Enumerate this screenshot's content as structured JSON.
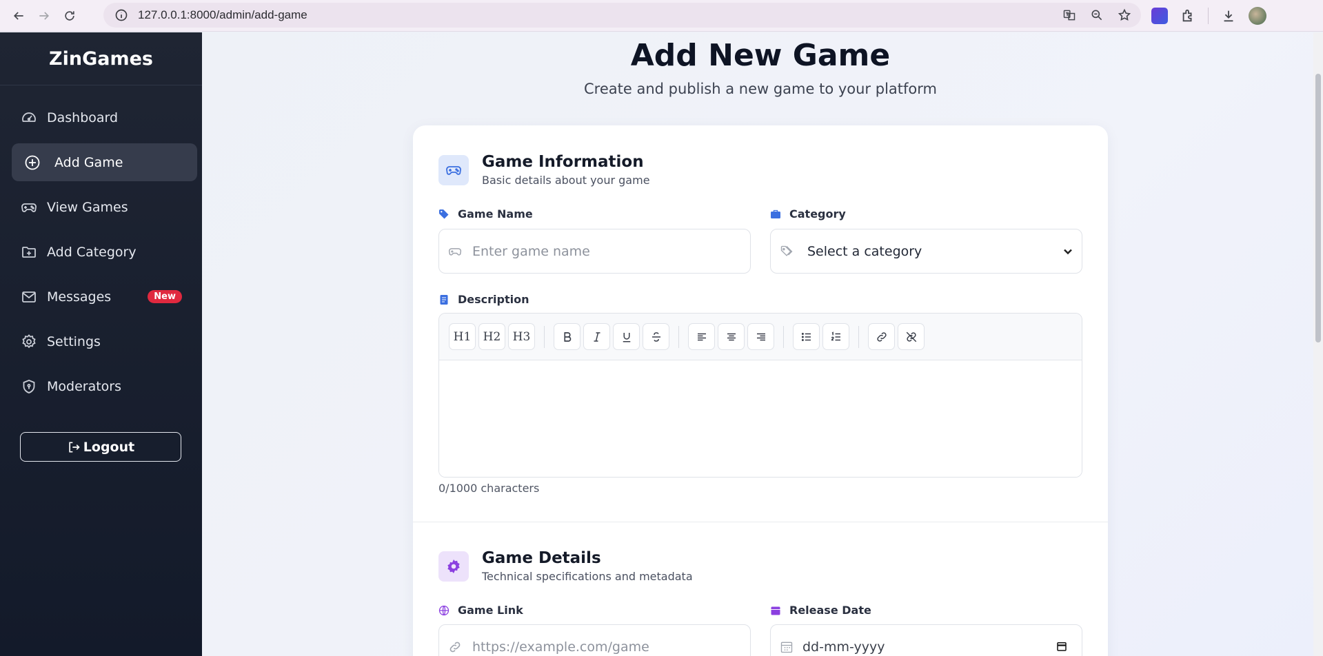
{
  "browser": {
    "url": "127.0.0.1:8000/admin/add-game"
  },
  "sidebar": {
    "brand": "ZinGames",
    "items": [
      {
        "label": "Dashboard"
      },
      {
        "label": "Add Game"
      },
      {
        "label": "View Games"
      },
      {
        "label": "Add Category"
      },
      {
        "label": "Messages",
        "badge": "New"
      },
      {
        "label": "Settings"
      },
      {
        "label": "Moderators"
      }
    ],
    "logout_label": "Logout"
  },
  "main": {
    "title": "Add New Game",
    "subtitle": "Create and publish a new game to your platform"
  },
  "game_info": {
    "title": "Game Information",
    "description": "Basic details about your game",
    "name_label": "Game Name",
    "name_placeholder": "Enter game name",
    "category_label": "Category",
    "category_value": "Select a category",
    "description_label": "Description",
    "toolbar": {
      "h1": "H1",
      "h2": "H2",
      "h3": "H3"
    },
    "char_count": "0/1000 characters"
  },
  "game_details": {
    "title": "Game Details",
    "description": "Technical specifications and metadata",
    "link_label": "Game Link",
    "link_placeholder": "https://example.com/game",
    "release_label": "Release Date",
    "release_placeholder": "dd-mm-yyyy"
  },
  "colors": {
    "sidebar_bg": "#1a2030",
    "accent_blue": "#3b6fe0",
    "accent_purple": "#8b3fe0",
    "badge_red": "#e0293f"
  }
}
